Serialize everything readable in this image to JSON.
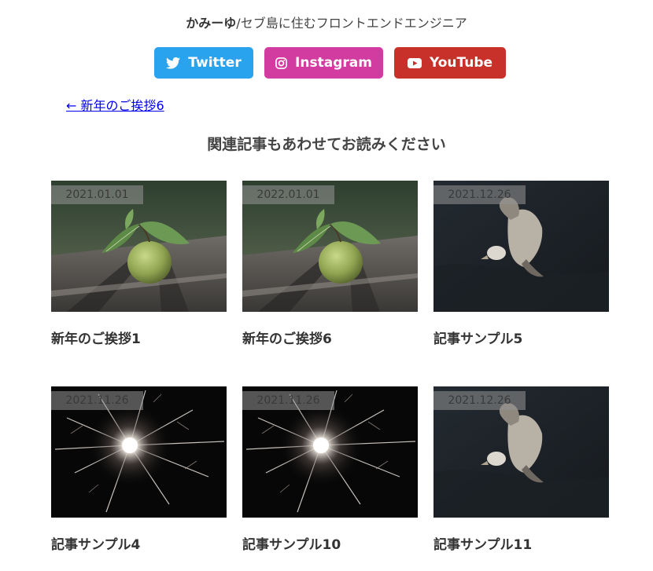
{
  "author": {
    "name": "かみーゆ",
    "tagline": "/セブ島に住むフロントエンドエンジニア"
  },
  "social": {
    "twitter": {
      "label": "Twitter",
      "icon": "twitter-bird-icon",
      "color": "#2aa3ef"
    },
    "instagram": {
      "label": "Instagram",
      "icon": "instagram-icon",
      "color": "#d23ba0"
    },
    "youtube": {
      "label": "YouTube",
      "icon": "youtube-play-icon",
      "color": "#c8302a"
    }
  },
  "prev_post": {
    "label": "← 新年のご挨拶6"
  },
  "related": {
    "heading": "関連記事もあわせてお読みください",
    "cards": [
      {
        "date": "2021.01.01",
        "title": "新年のご挨拶1",
        "image": "apple-on-table"
      },
      {
        "date": "2022.01.01",
        "title": "新年のご挨拶6",
        "image": "apple-on-table"
      },
      {
        "date": "2021.12.26",
        "title": "記事サンプル5",
        "image": "flying-seagull"
      },
      {
        "date": "2021.11.26",
        "title": "記事サンプル4",
        "image": "sparkler"
      },
      {
        "date": "2021.11.26",
        "title": "記事サンプル10",
        "image": "sparkler"
      },
      {
        "date": "2021.12.26",
        "title": "記事サンプル11",
        "image": "flying-seagull"
      }
    ]
  }
}
